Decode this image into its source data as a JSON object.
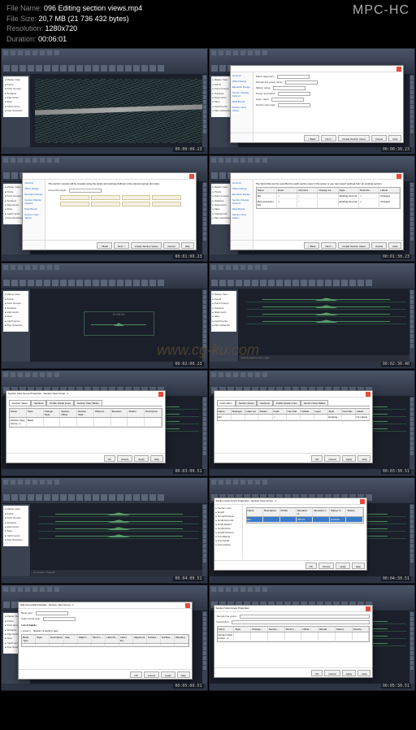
{
  "header": {
    "file_name_label": "File Name:",
    "file_name": "096 Editing section views.mp4",
    "file_size_label": "File Size:",
    "file_size": "20,7 MB (21 736 432 bytes)",
    "resolution_label": "Resolution:",
    "resolution": "1280x720",
    "duration_label": "Duration:",
    "duration": "00:06:01",
    "player": "MPC-HC"
  },
  "watermark": "www.cg-ku.com",
  "timestamps": [
    "00:00:00.23",
    "00:00:30.23",
    "00:01:00.23",
    "00:01:30.23",
    "00:02:00.23",
    "00:02:30.40",
    "00:03:00.51",
    "00:03:30.51",
    "00:04:00.51",
    "00:04:30.51",
    "00:05:00.51",
    "00:05:30.51"
  ],
  "thumbs": [
    {
      "type": "topo",
      "ts": "00:00:00.23"
    },
    {
      "type": "dialog-wizard",
      "ts": "00:00:30.23",
      "dialog": {
        "nav": [
          "General",
          "Offset Range",
          "Elevation Range",
          "Section Display Options",
          "Data Bands",
          "Section View Tables"
        ],
        "fields": [
          {
            "label": "Select alignment:",
            "value": ""
          },
          {
            "label": "Sample line group name:",
            "value": ""
          },
          {
            "label": "Station range",
            "value": ""
          },
          {
            "label": "Group description:",
            "value": ""
          },
          {
            "label": "Layer name:",
            "value": ""
          },
          {
            "label": "Section view style:",
            "value": ""
          }
        ],
        "buttons": [
          "< Back",
          "Next >",
          "Create Section Views",
          "Cancel",
          "Help"
        ]
      }
    },
    {
      "type": "dialog-text",
      "ts": "00:01:00.23",
      "dialog": {
        "text": "The section view(s) will be created using the styles and settings defined in the selected group plot style.",
        "group_label": "Group Plot Style:",
        "nav": [
          "General",
          "Offset Range",
          "Elevation Range",
          "Section Display Options",
          "Data Bands",
          "Section View Tables"
        ],
        "buttons": [
          "< Back",
          "Next >",
          "Create Section Views",
          "Cancel",
          "Help"
        ]
      }
    },
    {
      "type": "dialog-table",
      "ts": "00:01:30.23",
      "dialog": {
        "text": "The band (list) can be specified for each section view in the group or you can import settings from an existing section.",
        "nav": [
          "General",
          "Offset Range",
          "Elevation Range",
          "Section Display Options",
          "Data Bands",
          "Section View Tables"
        ],
        "columns": [
          "Name",
          "Draw",
          "Clip Grid",
          "Change La...",
          "Style",
          "Override...",
          "Labels"
        ],
        "rows": [
          [
            "EG",
            "✓",
            "○",
            "",
            "Existing Ground",
            "✓",
            "Changes"
          ],
          [
            "Reconstruction EG",
            "✓",
            "○",
            "",
            "Existing Ground",
            "✓",
            "Changes"
          ]
        ],
        "buttons": [
          "< Back",
          "Next >",
          "Create Section Views",
          "Cancel",
          "Help"
        ]
      }
    },
    {
      "type": "sections-single",
      "ts": "00:02:00.23",
      "label": "0+00.00"
    },
    {
      "type": "sections-multi",
      "ts": "00:02:30.40",
      "cmdline": "Identify section view origin:"
    },
    {
      "type": "dialog-props-tabs",
      "ts": "00:03:00.51",
      "dialog": {
        "title": "Section View Group Properties - Section View Group - 1",
        "tabs": [
          "Section Views",
          "Sections",
          "Profile Grade Lines",
          "Section View Tables"
        ],
        "columns": [
          "Name",
          "Style",
          "Change Style",
          "Section Offset",
          "Section Stati...",
          "Offset to...",
          "Elevation",
          "Station",
          "Description"
        ],
        "rows": [
          [
            "Section View Group - 1",
            "Basic",
            "",
            "",
            "",
            "",
            "",
            "",
            ""
          ]
        ],
        "buttons": [
          "OK",
          "Cancel",
          "Apply",
          "Help"
        ]
      }
    },
    {
      "type": "dialog-props-sections",
      "ts": "00:03:30.51",
      "dialog": {
        "tabs": [
          "Information",
          "Section Views",
          "Sections",
          "Profile Grade Lines",
          "Section View Tables"
        ],
        "columns": [
          "Name",
          "Style/gen",
          "Label set",
          "Station",
          "Draw",
          "Clip Grid",
          "Update...",
          "Layer",
          "Style",
          "Override...",
          "Labels"
        ],
        "rows": [
          [
            "EG",
            "",
            "",
            "",
            "✓",
            "",
            "",
            "",
            "Existing...",
            "",
            "No Labels"
          ]
        ],
        "buttons": [
          "OK",
          "Cancel",
          "Apply",
          "Help"
        ]
      }
    },
    {
      "type": "sections-multi",
      "ts": "00:04:00.51",
      "cmdline": "Command: *Cancel*"
    },
    {
      "type": "dialog-props-large",
      "ts": "00:04:30.51",
      "dialog": {
        "title": "Section View Group Properties - Section View Group - 1",
        "tree": [
          "Section view",
          "Graph",
          "GroupPlotStyle",
          "GridHorizontal",
          "GridLabelled",
          "GridVertical",
          "GraphViewport",
          "AnnoBands",
          "AnnoScale",
          "AnnoLabels"
        ],
        "columns": [
          "Name",
          "Description",
          "Profile",
          "Elevation H...",
          "Elevation L...",
          "Station S...",
          "Station"
        ],
        "rows": [
          [
            "EG",
            "",
            "",
            "205.31",
            "",
            "0+00.00",
            ""
          ]
        ],
        "buttons": [
          "OK",
          "Cancel",
          "Apply",
          "Help"
        ]
      }
    },
    {
      "type": "dialog-bands",
      "ts": "00:05:00.51",
      "dialog": {
        "title": "Edit Group Band Details - Section View Group - 1",
        "fields": [
          {
            "label": "Band type:",
            "value": "Section Data"
          },
          {
            "label": "Select band style:",
            "value": ""
          }
        ],
        "section_label": "List of bands",
        "location_label": "Location:",
        "location": "Bottom of section view",
        "columns": [
          "Band Type",
          "Style",
          "Description",
          "Gap",
          "Major L...",
          "Minor L...",
          "Label St...",
          "Label En...",
          "Alignment",
          "Surface...",
          "Surface...",
          "Weeding"
        ],
        "buttons": [
          "OK",
          "Cancel",
          "Apply",
          "Help"
        ]
      }
    },
    {
      "type": "dialog-props-short",
      "ts": "00:05:30.51",
      "dialog": {
        "title": "Section View Group Properties",
        "fields": [
          {
            "label": "Sample line group:",
            "value": ""
          },
          {
            "label": "Description:",
            "value": ""
          }
        ],
        "columns": [
          "Name",
          "Style",
          "Change...",
          "Section...",
          "Section...",
          "Offset...",
          "Elevati...",
          "Station",
          "Descrip..."
        ],
        "rows": [
          [
            "Section View Group - 1",
            "",
            "",
            "",
            "",
            "",
            "",
            "",
            ""
          ]
        ],
        "buttons": [
          "OK",
          "Cancel",
          "Apply",
          "Help"
        ]
      }
    }
  ],
  "tree_items": [
    "Master View",
    "Points",
    "Point Groups",
    "Surfaces",
    "Alignments",
    "Sites",
    "Catchments",
    "Pipe Networks"
  ]
}
